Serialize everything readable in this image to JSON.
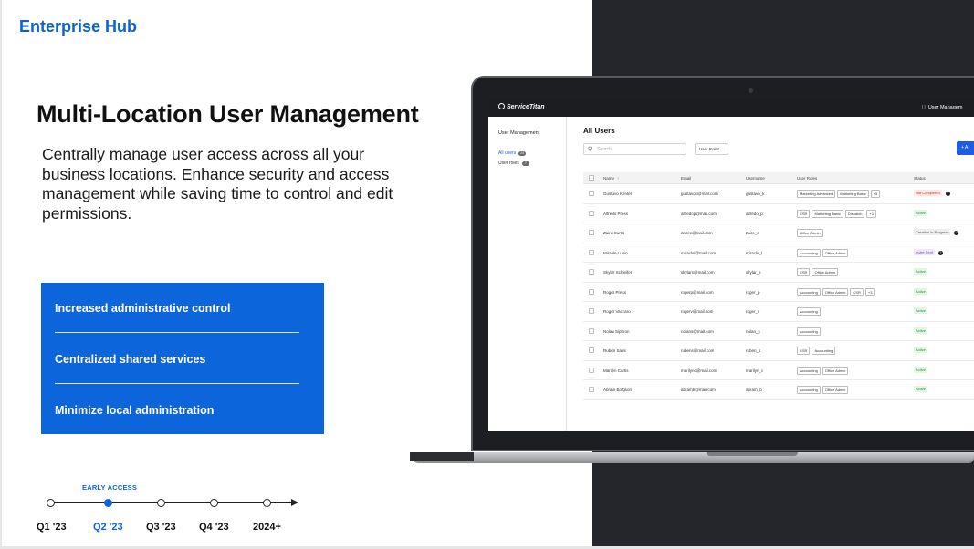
{
  "brand": "Enterprise Hub",
  "headline": "Multi-Location User Management",
  "description": "Centrally manage user access across all your business locations. Enhance security and access management while saving time to control and edit permissions.",
  "features": [
    "Increased administrative control",
    "Centralized shared services",
    "Minimize local administration"
  ],
  "timeline": {
    "badge": "EARLY ACCESS",
    "milestones": [
      "Q1 '23",
      "Q2 '23",
      "Q3 '23",
      "Q4 '23",
      "2024+"
    ],
    "active": "Q2 '23"
  },
  "colors": {
    "accent": "#0d65dc",
    "dark_panel": "#25262b",
    "app_primary": "#1d5ee0"
  },
  "app": {
    "logo": "ServiceTitan",
    "menu_label": "User Managem",
    "menu_icon": "grid-icon",
    "sidebar": {
      "title": "User Management",
      "items": [
        {
          "label": "All users",
          "count": "24"
        },
        {
          "label": "User roles",
          "count": "7"
        }
      ]
    },
    "title": "All Users",
    "search_placeholder": "Search",
    "roles_filter": "User Roles",
    "add_button": "+ A",
    "columns": [
      "Name",
      "Email",
      "Username",
      "User Roles",
      "Status"
    ],
    "rows": [
      {
        "name": "Gustavo Kenter",
        "email": "gustavok@mail.com",
        "username": "gustavo_k",
        "roles": [
          "Marketing Advanced",
          "Marketing Basic",
          "+5"
        ],
        "status": "Not Completed",
        "help": true
      },
      {
        "name": "Alfredo Press",
        "email": "alfredop@mail.com",
        "username": "alfredo_p",
        "roles": [
          "CSR",
          "Marketing Basic",
          "Dispatch",
          "+1"
        ],
        "status": "Active",
        "help": false
      },
      {
        "name": "Zaire Curtis",
        "email": "zairec@mail.com",
        "username": "zaire_c",
        "roles": [
          "Office Admin"
        ],
        "status": "Creation in Progress",
        "help": true
      },
      {
        "name": "Miracle Lubin",
        "email": "miraclel@mail.com",
        "username": "miracle_l",
        "roles": [
          "Accounting",
          "Office Admin"
        ],
        "status": "Invite Sent",
        "help": true
      },
      {
        "name": "Skylar Schleifer",
        "email": "skylars@mail.com",
        "username": "skylar_s",
        "roles": [
          "CSR",
          "Office Admin"
        ],
        "status": "Active",
        "help": false
      },
      {
        "name": "Roger Press",
        "email": "rogerp@mail.com",
        "username": "roger_p",
        "roles": [
          "Accounting",
          "Office Admin",
          "CSR",
          "+3"
        ],
        "status": "Active",
        "help": false
      },
      {
        "name": "Roger Vaccaro",
        "email": "rogerv@mail.com",
        "username": "roger_v",
        "roles": [
          "Accounting"
        ],
        "status": "Active",
        "help": false
      },
      {
        "name": "Nolan Siphron",
        "email": "nolans@mail.com",
        "username": "nolan_s",
        "roles": [
          "Accounting"
        ],
        "status": "Active",
        "help": false
      },
      {
        "name": "Ruben Saris",
        "email": "rubens@mail.com",
        "username": "ruben_s",
        "roles": [
          "CSR",
          "Accounting"
        ],
        "status": "Active",
        "help": false
      },
      {
        "name": "Marilyn Curtis",
        "email": "marilync@mail.com",
        "username": "marilyn_c",
        "roles": [
          "Accounting",
          "Office Admin"
        ],
        "status": "Active",
        "help": false
      },
      {
        "name": "Abram Botgson",
        "email": "abramb@mail.com",
        "username": "abram_b",
        "roles": [
          "Accounting",
          "Office Admin"
        ],
        "status": "Active",
        "help": false
      }
    ],
    "status_styles": {
      "Active": {
        "bg": "#e3f6e6",
        "fg": "#2e8b3d"
      },
      "Not Completed": {
        "bg": "#fde6e4",
        "fg": "#d0342c"
      },
      "Creation in Progress": {
        "bg": "#eeeeee",
        "fg": "#555555"
      },
      "Invite Sent": {
        "bg": "#efe7fb",
        "fg": "#7b47c9"
      }
    }
  }
}
